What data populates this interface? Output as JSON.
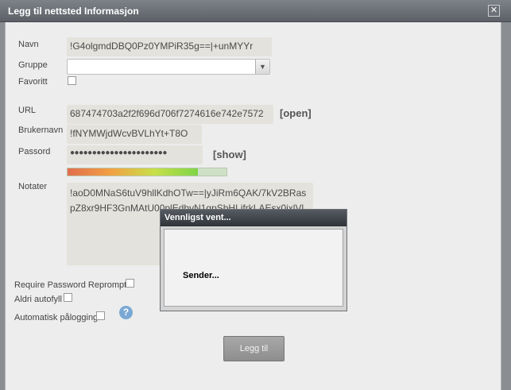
{
  "window": {
    "title": "Legg til nettsted Informasjon",
    "close_symbol": "✕"
  },
  "form": {
    "name_label": "Navn",
    "name_value": "!G4olgmdDBQ0Pz0YMPiR35g==|+unMYYr",
    "group_label": "Gruppe",
    "group_value": "",
    "favorite_label": "Favoritt",
    "url_label": "URL",
    "url_value": "687474703a2f2f696d706f7274616e742e7572",
    "open_label": "[open]",
    "username_label": "Brukernavn",
    "username_value": "!fNYMWjdWcvBVLhYt+T8O",
    "password_label": "Passord",
    "password_value": "●●●●●●●●●●●●●●●●●●●●●●",
    "show_label": "[show]",
    "password_strength": 0.82,
    "notes_label": "Notater",
    "notes_value": "!aoD0MNaS6tuV9hllKdhOTw==|yJiRm6QAK/7kV2BRaspZ8xr9HF3GnMAtU00plEdbvN1gpSbHLifrkLAEsx0jxlVl",
    "reprompt_label": "Require Password Reprompt",
    "never_autofill_label": "Aldri autofyll",
    "auto_login_label": "Automatisk pålogging",
    "help_symbol": "?",
    "submit_label": "Legg til"
  },
  "modal": {
    "title": "Vennligst vent...",
    "message": "Sender..."
  }
}
